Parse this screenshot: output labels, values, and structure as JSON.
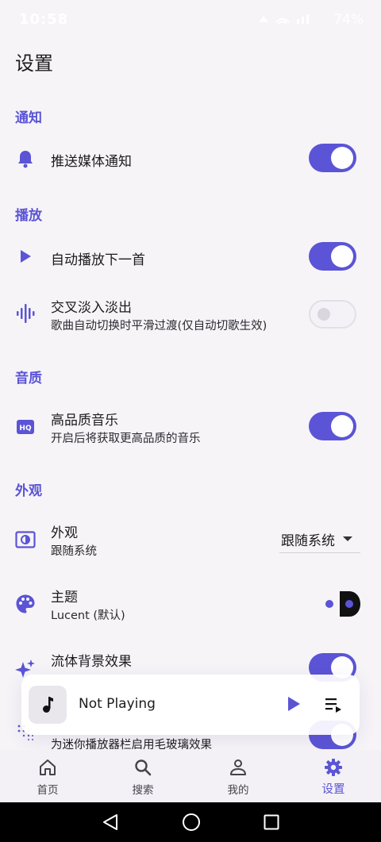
{
  "status": {
    "time": "10:58",
    "battery": "74%"
  },
  "page": {
    "title": "设置"
  },
  "sections": {
    "notify": "通知",
    "playback": "播放",
    "quality": "音质",
    "appearance": "外观"
  },
  "settings": {
    "push_notification": {
      "title": "推送媒体通知",
      "enabled": true
    },
    "autoplay_next": {
      "title": "自动播放下一首",
      "enabled": true
    },
    "crossfade": {
      "title": "交叉淡入淡出",
      "subtitle": "歌曲自动切换时平滑过渡(仅自动切歌生效)",
      "enabled": false
    },
    "high_quality": {
      "title": "高品质音乐",
      "subtitle": "开启后将获取更高品质的音乐",
      "enabled": true
    },
    "appearance": {
      "title": "外观",
      "subtitle": "跟随系统",
      "selected": "跟随系统"
    },
    "theme": {
      "title": "主题",
      "subtitle": "Lucent (默认)"
    },
    "fluid_background": {
      "title": "流体背景效果",
      "enabled": true
    },
    "frosted_glass": {
      "subtitle": "为迷你播放器栏启用毛玻璃效果",
      "enabled": true
    }
  },
  "mini_player": {
    "title": "Not Playing"
  },
  "nav": {
    "items": [
      {
        "label": "首页",
        "icon": "home-icon"
      },
      {
        "label": "搜索",
        "icon": "search-icon"
      },
      {
        "label": "我的",
        "icon": "person-icon"
      },
      {
        "label": "设置",
        "icon": "gear-icon",
        "active": true
      }
    ]
  },
  "colors": {
    "accent": "#5b54d6",
    "background": "#f6f4f7"
  }
}
